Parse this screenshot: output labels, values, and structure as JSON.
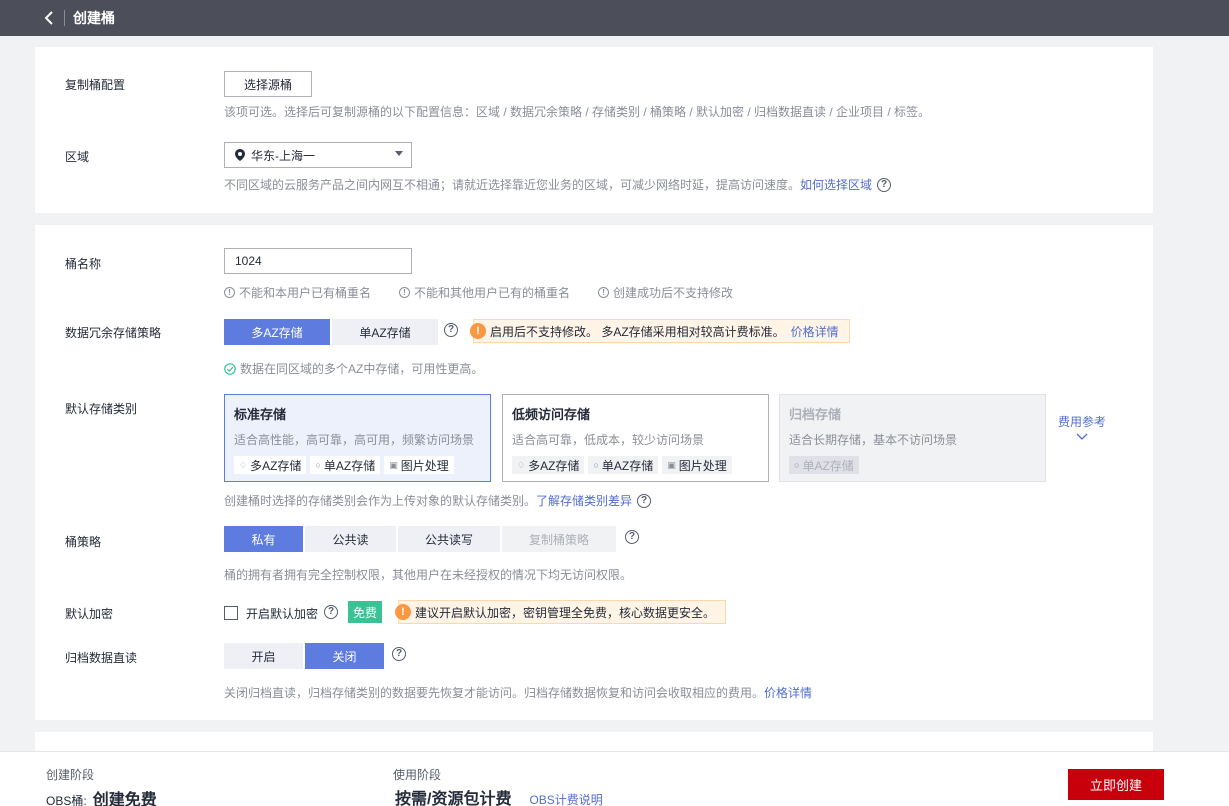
{
  "header": {
    "title": "创建桶"
  },
  "section1": {
    "replicate": {
      "label": "复制桶配置",
      "button": "选择源桶",
      "hint": "该项可选。选择后可复制源桶的以下配置信息：区域 / 数据冗余策略 / 存储类别 / 桶策略 / 默认加密 / 归档数据直读 / 企业项目 / 标签。"
    },
    "region": {
      "label": "区域",
      "value": "华东-上海一",
      "hint": "不同区域的云服务产品之间内网互不相通；请就近选择靠近您业务的区域，可减少网络时延，提高访问速度。",
      "hint_link": "如何选择区域"
    }
  },
  "section2": {
    "bucket_name": {
      "label": "桶名称",
      "value": "1024",
      "rules": [
        "不能和本用户已有桶重名",
        "不能和其他用户已有的桶重名",
        "创建成功后不支持修改"
      ]
    },
    "redundancy": {
      "label": "数据冗余存储策略",
      "options": [
        "多AZ存储",
        "单AZ存储"
      ],
      "selected": "多AZ存储",
      "warning": "启用后不支持修改。 多AZ存储采用相对较高计费标准。",
      "warning_link": "价格详情",
      "success_hint": "数据在同区域的多个AZ中存储，可用性更高。"
    },
    "storage_class": {
      "label": "默认存储类别",
      "cards": [
        {
          "title": "标准存储",
          "desc": "适合高性能，高可靠，高可用，频繁访问场景",
          "tags": [
            "多AZ存储",
            "单AZ存储",
            "图片处理"
          ]
        },
        {
          "title": "低频访问存储",
          "desc": "适合高可靠，低成本，较少访问场景",
          "tags": [
            "多AZ存储",
            "单AZ存储",
            "图片处理"
          ]
        },
        {
          "title": "归档存储",
          "desc": "适合长期存储，基本不访问场景",
          "tags": [
            "单AZ存储"
          ]
        }
      ],
      "selected": "标准存储",
      "fee_ref": "费用参考",
      "hint": "创建桶时选择的存储类别会作为上传对象的默认存储类别。",
      "hint_link": "了解存储类别差异"
    },
    "policy": {
      "label": "桶策略",
      "options": [
        "私有",
        "公共读",
        "公共读写",
        "复制桶策略"
      ],
      "selected": "私有",
      "hint": "桶的拥有者拥有完全控制权限，其他用户在未经授权的情况下均无访问权限。"
    },
    "encryption": {
      "label": "默认加密",
      "checkbox_label": "开启默认加密",
      "checked": false,
      "badge": "免费",
      "warning": "建议开启默认加密，密钥管理全免费，核心数据更安全。"
    },
    "archive_read": {
      "label": "归档数据直读",
      "options": [
        "开启",
        "关闭"
      ],
      "selected": "关闭",
      "hint": "关闭归档直读，归档存储类别的数据要先恢复才能访问。归档存储数据恢复和访问会收取相应的费用。",
      "hint_link": "价格详情"
    }
  },
  "footer": {
    "stage1_title": "创建阶段",
    "stage1_prefix": "OBS桶:",
    "stage1_value": "创建免费",
    "stage2_title": "使用阶段",
    "stage2_value": "按需/资源包计费",
    "stage2_link": "OBS计费说明",
    "create_button": "立即创建"
  },
  "colors": {
    "accent": "#5e7ce0",
    "primary_button": "#c7000b",
    "header_bg": "#4c4e59",
    "warning_bg": "#fff4e6",
    "free_badge": "#3ac295"
  }
}
